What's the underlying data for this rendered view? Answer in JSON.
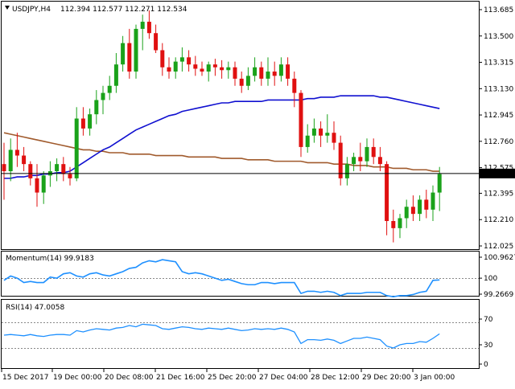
{
  "header": {
    "symbol": "USDJPY,H4",
    "ohlc": "112.394 112.577 112.271 112.534"
  },
  "colors": {
    "bull": "#1aa21a",
    "bear": "#e01010",
    "sma_fast": "#1010d0",
    "sma_slow": "#a05a2c",
    "momentum": "#1e90ff",
    "rsi": "#1e90ff",
    "price_tag_bg": "#000000",
    "price_tag_fg": "#ffffff"
  },
  "price_axis": {
    "ticks": [
      "113.685",
      "113.500",
      "113.315",
      "113.130",
      "112.945",
      "112.760",
      "112.575",
      "112.395",
      "112.210",
      "112.025"
    ],
    "current_price": "112.534"
  },
  "momentum": {
    "label": "Momentum(14) 99.9183",
    "ticks": [
      "100.9627",
      "100",
      "99.2669"
    ]
  },
  "rsi": {
    "label": "RSI(14) 47.0058",
    "ticks": [
      "70",
      "30",
      "0"
    ]
  },
  "time_axis": {
    "labels": [
      "15 Dec 2017",
      "19 Dec 00:00",
      "20 Dec 08:00",
      "21 Dec 16:00",
      "25 Dec 20:00",
      "27 Dec 04:00",
      "28 Dec 12:00",
      "29 Dec 20:00",
      "3 Jan 00:00"
    ]
  },
  "chart_data": {
    "type": "candlestick",
    "symbol": "USDJPY",
    "timeframe": "H4",
    "ylim": [
      112.0,
      113.74
    ],
    "candles": [
      [
        112.6,
        112.75,
        112.35,
        112.55
      ],
      [
        112.55,
        112.78,
        112.48,
        112.7
      ],
      [
        112.7,
        112.82,
        112.58,
        112.66
      ],
      [
        112.66,
        112.72,
        112.55,
        112.6
      ],
      [
        112.6,
        112.62,
        112.45,
        112.5
      ],
      [
        112.5,
        112.6,
        112.3,
        112.4
      ],
      [
        112.4,
        112.55,
        112.32,
        112.52
      ],
      [
        112.52,
        112.62,
        112.44,
        112.55
      ],
      [
        112.55,
        112.64,
        112.48,
        112.6
      ],
      [
        112.6,
        112.65,
        112.48,
        112.53
      ],
      [
        112.53,
        112.58,
        112.45,
        112.5
      ],
      [
        112.5,
        113.0,
        112.48,
        112.92
      ],
      [
        112.92,
        113.0,
        112.8,
        112.85
      ],
      [
        112.85,
        112.99,
        112.8,
        112.95
      ],
      [
        112.95,
        113.12,
        112.88,
        113.05
      ],
      [
        113.05,
        113.15,
        112.95,
        113.1
      ],
      [
        113.1,
        113.22,
        113.05,
        113.15
      ],
      [
        113.15,
        113.38,
        113.1,
        113.3
      ],
      [
        113.3,
        113.5,
        113.25,
        113.45
      ],
      [
        113.45,
        113.55,
        113.2,
        113.25
      ],
      [
        113.25,
        113.58,
        113.2,
        113.55
      ],
      [
        113.55,
        113.65,
        113.4,
        113.6
      ],
      [
        113.6,
        113.68,
        113.48,
        113.52
      ],
      [
        113.52,
        113.58,
        113.38,
        113.4
      ],
      [
        113.4,
        113.45,
        113.22,
        113.28
      ],
      [
        113.28,
        113.35,
        113.2,
        113.25
      ],
      [
        113.25,
        113.35,
        113.2,
        113.32
      ],
      [
        113.32,
        113.42,
        113.25,
        113.35
      ],
      [
        113.35,
        113.4,
        113.25,
        113.3
      ],
      [
        113.3,
        113.36,
        113.22,
        113.27
      ],
      [
        113.27,
        113.32,
        113.22,
        113.25
      ],
      [
        113.25,
        113.32,
        113.18,
        113.3
      ],
      [
        113.3,
        113.34,
        113.22,
        113.28
      ],
      [
        113.28,
        113.33,
        113.2,
        113.26
      ],
      [
        113.26,
        113.32,
        113.2,
        113.28
      ],
      [
        113.28,
        113.32,
        113.15,
        113.2
      ],
      [
        113.2,
        113.25,
        113.1,
        113.15
      ],
      [
        113.15,
        113.28,
        113.12,
        113.22
      ],
      [
        113.22,
        113.35,
        113.18,
        113.28
      ],
      [
        113.28,
        113.32,
        113.15,
        113.2
      ],
      [
        113.2,
        113.35,
        113.15,
        113.25
      ],
      [
        113.25,
        113.32,
        113.15,
        113.22
      ],
      [
        113.22,
        113.35,
        113.18,
        113.3
      ],
      [
        113.3,
        113.35,
        113.15,
        113.2
      ],
      [
        113.2,
        113.25,
        113.0,
        113.1
      ],
      [
        113.1,
        113.12,
        112.65,
        112.72
      ],
      [
        112.72,
        112.88,
        112.68,
        112.8
      ],
      [
        112.8,
        112.92,
        112.75,
        112.85
      ],
      [
        112.85,
        112.9,
        112.72,
        112.8
      ],
      [
        112.8,
        112.95,
        112.75,
        112.82
      ],
      [
        112.82,
        112.9,
        112.7,
        112.75
      ],
      [
        112.75,
        112.8,
        112.45,
        112.5
      ],
      [
        112.5,
        112.65,
        112.45,
        112.6
      ],
      [
        112.6,
        112.68,
        112.55,
        112.65
      ],
      [
        112.65,
        112.75,
        112.55,
        112.62
      ],
      [
        112.62,
        112.78,
        112.58,
        112.72
      ],
      [
        112.72,
        112.78,
        112.6,
        112.65
      ],
      [
        112.65,
        112.72,
        112.55,
        112.6
      ],
      [
        112.6,
        112.62,
        112.1,
        112.2
      ],
      [
        112.2,
        112.28,
        112.05,
        112.15
      ],
      [
        112.15,
        112.25,
        112.08,
        112.22
      ],
      [
        112.22,
        112.35,
        112.15,
        112.3
      ],
      [
        112.3,
        112.38,
        112.2,
        112.25
      ],
      [
        112.25,
        112.38,
        112.2,
        112.35
      ],
      [
        112.35,
        112.42,
        112.22,
        112.28
      ],
      [
        112.28,
        112.45,
        112.2,
        112.4
      ],
      [
        112.4,
        112.58,
        112.27,
        112.53
      ]
    ],
    "sma_fast": [
      112.5,
      112.5,
      112.51,
      112.51,
      112.52,
      112.52,
      112.53,
      112.53,
      112.54,
      112.54,
      112.55,
      112.58,
      112.61,
      112.64,
      112.67,
      112.7,
      112.72,
      112.75,
      112.78,
      112.81,
      112.84,
      112.86,
      112.88,
      112.9,
      112.92,
      112.94,
      112.95,
      112.97,
      112.98,
      112.99,
      113.0,
      113.01,
      113.02,
      113.03,
      113.03,
      113.04,
      113.04,
      113.04,
      113.04,
      113.04,
      113.05,
      113.05,
      113.05,
      113.05,
      113.05,
      113.05,
      113.06,
      113.06,
      113.07,
      113.07,
      113.07,
      113.08,
      113.08,
      113.08,
      113.08,
      113.08,
      113.08,
      113.07,
      113.07,
      113.06,
      113.05,
      113.04,
      113.03,
      113.02,
      113.01,
      113.0,
      112.99
    ],
    "sma_slow": [
      112.82,
      112.81,
      112.8,
      112.79,
      112.78,
      112.77,
      112.76,
      112.75,
      112.74,
      112.73,
      112.72,
      112.71,
      112.7,
      112.7,
      112.69,
      112.69,
      112.68,
      112.68,
      112.68,
      112.67,
      112.67,
      112.67,
      112.67,
      112.66,
      112.66,
      112.66,
      112.66,
      112.66,
      112.65,
      112.65,
      112.65,
      112.65,
      112.65,
      112.64,
      112.64,
      112.64,
      112.64,
      112.63,
      112.63,
      112.63,
      112.63,
      112.62,
      112.62,
      112.62,
      112.62,
      112.62,
      112.61,
      112.61,
      112.61,
      112.61,
      112.6,
      112.6,
      112.6,
      112.59,
      112.59,
      112.59,
      112.58,
      112.58,
      112.58,
      112.57,
      112.57,
      112.57,
      112.56,
      112.56,
      112.56,
      112.55,
      112.55
    ],
    "momentum_values": [
      99.9,
      100.1,
      100.0,
      99.8,
      99.85,
      99.8,
      99.8,
      100.05,
      100.0,
      100.2,
      100.25,
      100.1,
      100.05,
      100.2,
      100.25,
      100.15,
      100.1,
      100.2,
      100.3,
      100.45,
      100.5,
      100.7,
      100.8,
      100.75,
      100.85,
      100.8,
      100.75,
      100.3,
      100.2,
      100.25,
      100.2,
      100.1,
      100.0,
      99.9,
      99.95,
      99.85,
      99.75,
      99.7,
      99.7,
      99.8,
      99.8,
      99.75,
      99.8,
      99.8,
      99.8,
      99.3,
      99.4,
      99.4,
      99.35,
      99.4,
      99.35,
      99.2,
      99.3,
      99.3,
      99.3,
      99.35,
      99.35,
      99.35,
      99.2,
      99.15,
      99.2,
      99.2,
      99.25,
      99.35,
      99.4,
      99.9,
      99.92
    ],
    "rsi_values": [
      45,
      46,
      45,
      44,
      46,
      44,
      43,
      45,
      46,
      46,
      45,
      52,
      50,
      53,
      55,
      54,
      53,
      56,
      57,
      60,
      58,
      62,
      61,
      60,
      55,
      54,
      56,
      58,
      57,
      55,
      54,
      56,
      55,
      54,
      56,
      54,
      52,
      53,
      55,
      54,
      55,
      54,
      56,
      54,
      50,
      32,
      38,
      38,
      37,
      39,
      37,
      32,
      36,
      40,
      40,
      42,
      40,
      38,
      28,
      25,
      30,
      32,
      32,
      35,
      34,
      40,
      47
    ]
  }
}
